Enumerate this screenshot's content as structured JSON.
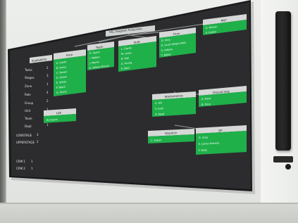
{
  "board": {
    "title": "VEL Diagram Fullscreen",
    "sidebar_header": "Availability",
    "rows": [
      {
        "label": "Tasks",
        "value": "2"
      },
      {
        "label": "Stages",
        "value": "3"
      },
      {
        "label": "Zone",
        "value": "1"
      },
      {
        "label": "Role",
        "value": "4"
      },
      {
        "label": "Group",
        "value": "2"
      },
      {
        "label": "Unit",
        "value": "1"
      },
      {
        "label": "Team",
        "value": "2"
      },
      {
        "label": "Dept",
        "value": "1"
      }
    ],
    "footer_rows": [
      {
        "label": "LOWSTAGE",
        "value": "3"
      },
      {
        "label": "UPPERSTAGE",
        "value": "2"
      },
      {
        "label": "CRM 1",
        "value": "1"
      },
      {
        "label": "CRM 2",
        "value": "1"
      }
    ],
    "panels": [
      {
        "title": "Area",
        "items": [
          "A. Smith",
          "B. Jones",
          "C. Brown",
          "D. Green",
          "E. White",
          "F. Black",
          "G. Stone"
        ]
      },
      {
        "title": "Team",
        "items": [
          "H. Taylor",
          "I. Walker",
          "J. Martin",
          "K. Wilson Rivers"
        ]
      },
      {
        "title": "Shift",
        "items": [
          "L. Clarke",
          "M. Lewis",
          "N. Hall",
          "O. Young",
          "P. Allen"
        ]
      },
      {
        "title": "Flow",
        "items": [
          "Q. King",
          "R. Scott Wright Kelly",
          "S. Adams",
          "T. Baker"
        ]
      },
      {
        "title": "PNT",
        "items": [
          "U. Nelson",
          "V. Carter"
        ]
      },
      {
        "title": "Lab",
        "items": [
          "W. Evans"
        ]
      },
      {
        "title": "Maintenance",
        "items": [
          "X. Hill",
          "Y. Cook",
          "Z. Reed"
        ]
      },
      {
        "title": "Ground Hub",
        "items": [
          "A. Ward",
          "B. Price"
        ]
      },
      {
        "title": "Dispatch",
        "items": [
          "C. Foster"
        ]
      },
      {
        "title": "QP",
        "items": [
          "D. Gray",
          "E. James Roberts",
          "F. Kelly"
        ]
      }
    ]
  }
}
